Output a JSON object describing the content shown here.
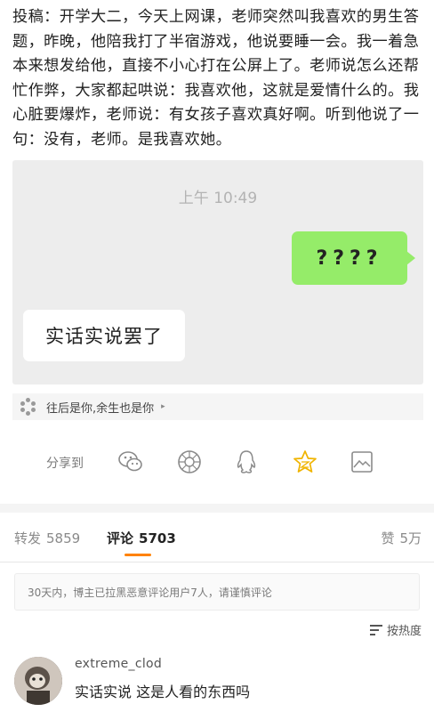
{
  "post": {
    "text": "投稿：开学大二，今天上网课，老师突然叫我喜欢的男生答题，昨晚，他陪我打了半宿游戏，他说要睡一会。我一着急本来想发给他，直接不小心打在公屏上了。老师说怎么还帮忙作弊，大家都起哄说：我喜欢他，这就是爱情什么的。我心脏要爆炸，老师说：有女孩子喜欢真好啊。听到他说了一句：没有，老师。是我喜欢她。"
  },
  "chat": {
    "time": "上午 10:49",
    "right_message": "????",
    "left_message": "实话实说罢了",
    "colors": {
      "background": "#ededed",
      "sent_bubble": "#95ec69",
      "received_bubble": "#ffffff"
    }
  },
  "topic": {
    "label": "往后是你,余生也是你",
    "arrow": "▸"
  },
  "share": {
    "label": "分享到",
    "icons": [
      "wechat-icon",
      "moments-icon",
      "qq-icon",
      "qzone-icon",
      "save-image-icon"
    ]
  },
  "stats": {
    "repost_label": "转发",
    "repost_count": "5859",
    "comment_label": "评论",
    "comment_count": "5703",
    "like_label": "赞",
    "like_count": "5万",
    "accent": "#ff8200"
  },
  "notice": {
    "text": "30天内，博主已拉黑恶意评论用户7人，请谨慎评论"
  },
  "sort": {
    "label": "按热度"
  },
  "comments": [
    {
      "user": "extreme_clod",
      "text": "实话实说 这是人看的东西吗"
    }
  ]
}
